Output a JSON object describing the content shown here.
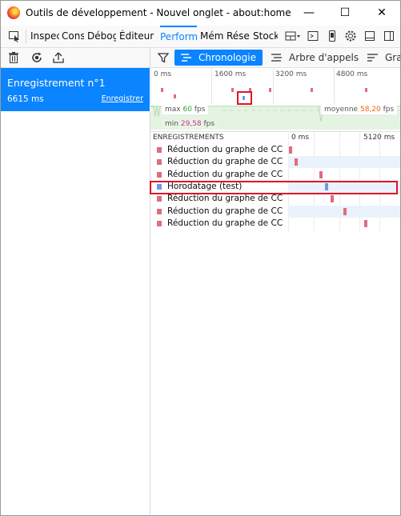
{
  "window": {
    "title": "Outils de développement - Nouvel onglet - about:home",
    "minimize": "—",
    "maximize": "☐",
    "close": "✕"
  },
  "toolbox": {
    "tabs": [
      {
        "label": "Inspec",
        "icon": "inspector-icon"
      },
      {
        "label": "Cons",
        "icon": "console-icon"
      },
      {
        "label": "Débog",
        "icon": "debugger-icon"
      },
      {
        "label": "Éditeur d",
        "icon": "style-editor-icon"
      },
      {
        "label": "Perform",
        "icon": "performance-icon",
        "active": true
      },
      {
        "label": "Mém",
        "icon": "memory-icon"
      },
      {
        "label": "Rése",
        "icon": "network-icon"
      },
      {
        "label": "Stock",
        "icon": "storage-icon"
      }
    ],
    "right_icons": [
      "layout-icon",
      "dropdown-icon",
      "console-split-icon",
      "responsive-icon",
      "settings-icon",
      "dock-icon",
      "close-icon"
    ]
  },
  "left": {
    "icons": [
      "trash-icon",
      "record-icon",
      "import-icon"
    ],
    "recording": {
      "title": "Enregistrement n°1",
      "duration": "6615 ms",
      "save_label": "Enregistrer"
    }
  },
  "right": {
    "tabs": [
      {
        "label": "Chronologie",
        "icon": "timeline-icon",
        "selected": true
      },
      {
        "label": "Arbre d'appels",
        "icon": "call-tree-icon"
      },
      {
        "label": "Gra",
        "icon": "flame-graph-icon"
      }
    ],
    "filter_icon": "filter-icon"
  },
  "overview": {
    "ticks": [
      "0 ms",
      "1600 ms",
      "3200 ms",
      "4800 ms"
    ],
    "fps": {
      "max_label": "max",
      "max_value": "60",
      "max_unit": "fps",
      "avg_label": "moyenne",
      "avg_value": "58,20",
      "avg_unit": "fps",
      "min_label": "min",
      "min_value": "29,58",
      "min_unit": "fps"
    }
  },
  "waterfall": {
    "header": "ENREGISTREMENTS",
    "ticks": [
      "0 ms",
      "5120 ms"
    ],
    "rows": [
      {
        "label": "Réduction du graphe de CC",
        "color": "#e06c7f",
        "pos": 0.01
      },
      {
        "label": "Réduction du graphe de CC",
        "color": "#e06c7f",
        "pos": 0.06
      },
      {
        "label": "Réduction du graphe de CC",
        "color": "#e06c7f",
        "pos": 0.28
      },
      {
        "label": "Horodatage (test)",
        "color": "#6b9ae8",
        "pos": 0.33,
        "highlighted": true
      },
      {
        "label": "Réduction du graphe de CC",
        "color": "#e06c7f",
        "pos": 0.38
      },
      {
        "label": "Réduction du graphe de CC",
        "color": "#e06c7f",
        "pos": 0.49
      },
      {
        "label": "Réduction du graphe de CC",
        "color": "#e06c7f",
        "pos": 0.68
      }
    ]
  }
}
